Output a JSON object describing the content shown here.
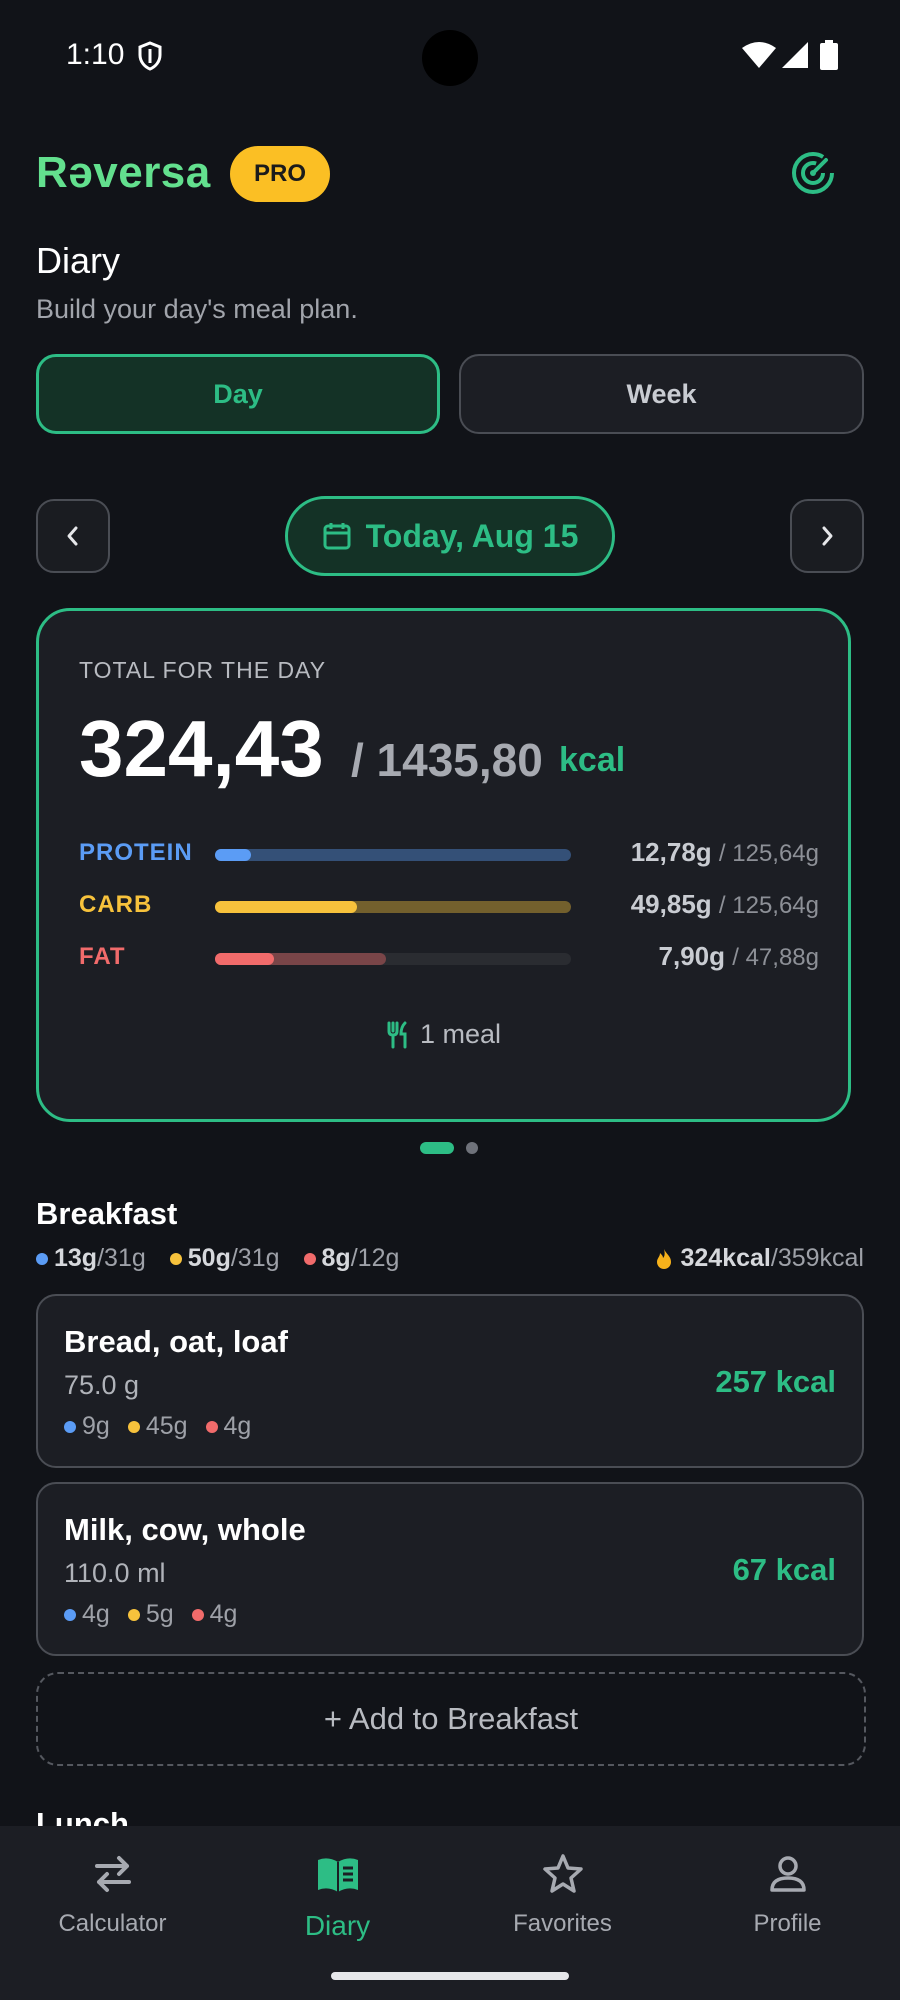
{
  "status": {
    "time": "1:10"
  },
  "app": {
    "brand": "Rəversa",
    "badge": "PRO"
  },
  "page": {
    "title": "Diary",
    "subtitle": "Build your day's meal plan."
  },
  "toggle": {
    "day": "Day",
    "week": "Week",
    "selected": "Day"
  },
  "date": {
    "label": "Today, Aug 15"
  },
  "summary": {
    "label": "TOTAL FOR THE DAY",
    "consumed": "324,43",
    "goal": "/ 1435,80",
    "unit": "kcal",
    "macros": [
      {
        "name": "PROTEIN",
        "value": "12,78g",
        "goal": "/ 125,64g",
        "color": "#5b9cf5",
        "fill": 0.1,
        "ghost": 1.0
      },
      {
        "name": "CARB",
        "value": "49,85g",
        "goal": "/ 125,64g",
        "color": "#f7c23c",
        "fill": 0.4,
        "ghost": 1.0
      },
      {
        "name": "FAT",
        "value": "7,90g",
        "goal": "/ 47,88g",
        "color": "#f16b6b",
        "fill": 0.165,
        "ghost": 0.48
      }
    ],
    "meals": "1 meal"
  },
  "breakfast": {
    "title": "Breakfast",
    "protein": "13g",
    "protein_goal": "/31g",
    "carb": "50g",
    "carb_goal": "/31g",
    "fat": "8g",
    "fat_goal": "/12g",
    "kcal": "324kcal",
    "kcal_goal": "/359kcal",
    "items": [
      {
        "name": "Bread, oat, loaf",
        "qty": "75.0 g",
        "p": "9g",
        "c": "45g",
        "f": "4g",
        "kcal": "257 kcal"
      },
      {
        "name": "Milk, cow, whole",
        "qty": "110.0 ml",
        "p": "4g",
        "c": "5g",
        "f": "4g",
        "kcal": "67 kcal"
      }
    ],
    "add": "+ Add to Breakfast"
  },
  "lunch": {
    "title": "Lunch"
  },
  "nav": [
    {
      "label": "Calculator",
      "icon": "swap-icon"
    },
    {
      "label": "Diary",
      "icon": "book-icon",
      "active": true
    },
    {
      "label": "Favorites",
      "icon": "star-icon"
    },
    {
      "label": "Profile",
      "icon": "person-icon"
    }
  ]
}
